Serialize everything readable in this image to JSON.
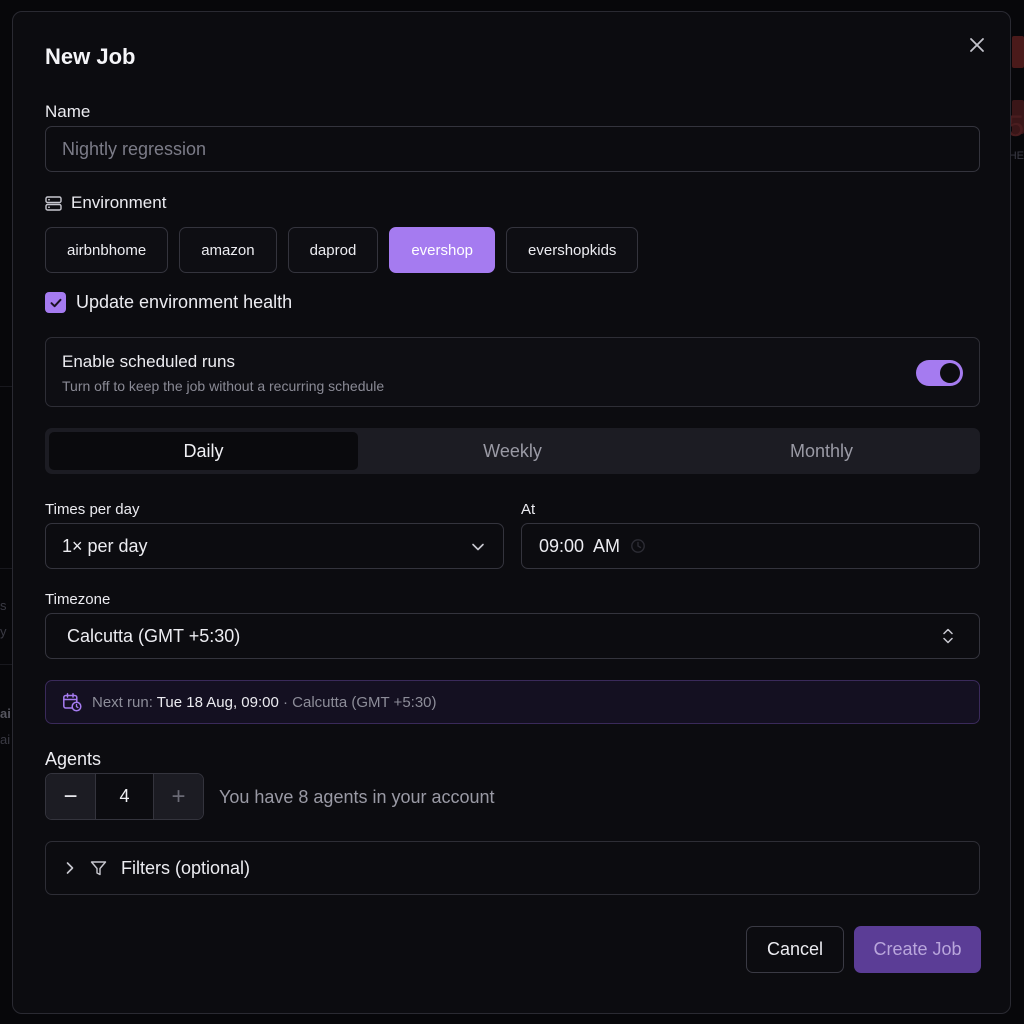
{
  "dialog": {
    "title": "New Job",
    "name_label": "Name",
    "name_placeholder": "Nightly regression",
    "environment_label": "Environment",
    "environments": [
      {
        "label": "airbnbhome",
        "selected": false
      },
      {
        "label": "amazon",
        "selected": false
      },
      {
        "label": "daprod",
        "selected": false
      },
      {
        "label": "evershop",
        "selected": true
      },
      {
        "label": "evershopkids",
        "selected": false
      }
    ],
    "update_health_label": "Update environment health",
    "update_health_checked": true,
    "schedule": {
      "title": "Enable scheduled runs",
      "subtitle": "Turn off to keep the job without a recurring schedule",
      "enabled": true,
      "tabs": [
        {
          "label": "Daily",
          "active": true
        },
        {
          "label": "Weekly",
          "active": false
        },
        {
          "label": "Monthly",
          "active": false
        }
      ],
      "times_label": "Times per day",
      "times_value": "1× per day",
      "at_label": "At",
      "at_value": "09:00  AM",
      "timezone_label": "Timezone",
      "timezone_value": "Calcutta (GMT +5:30)",
      "next_run_prefix": "Next run:",
      "next_run_value": "Tue 18 Aug, 09:00",
      "next_run_suffix": "· Calcutta (GMT +5:30)"
    },
    "agents": {
      "label": "Agents",
      "minus": "−",
      "value": "4",
      "plus": "+",
      "note": "You have 8 agents in your account"
    },
    "filters_label": "Filters (optional)",
    "cancel_label": "Cancel",
    "create_label": "Create Job"
  },
  "background": {
    "fragments": [
      "5",
      "HE",
      "s",
      "y",
      "ai",
      "ai"
    ]
  },
  "colors": {
    "accent": "#a57bf0",
    "create_button": "#5b3d96",
    "panel": "#0c0c10"
  }
}
